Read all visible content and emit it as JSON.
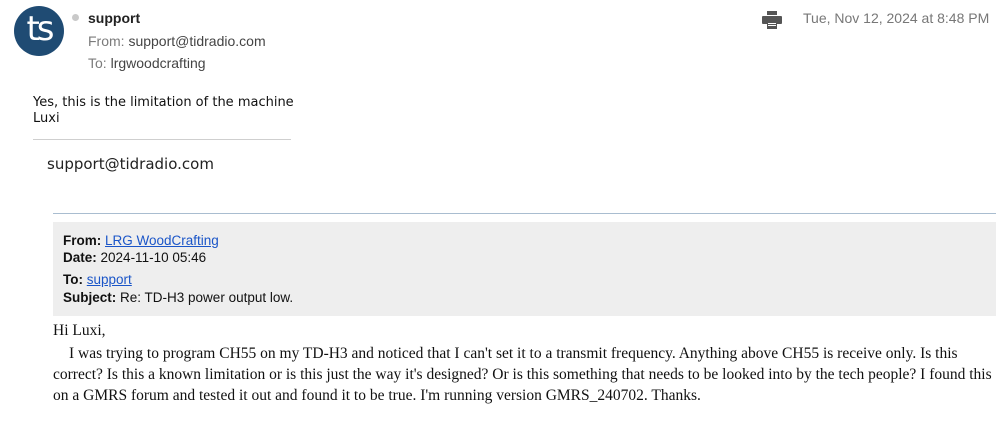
{
  "header": {
    "avatar_initials": "ts",
    "sender_name": "support",
    "from_label": "From:",
    "from_address": "support@tidradio.com",
    "to_label": "To:",
    "to_address": "lrgwoodcrafting",
    "print_icon": "printer-icon",
    "date": "Tue, Nov 12, 2024 at 8:48 PM"
  },
  "reply": {
    "line1": "Yes, this is the limitation of the machine",
    "line2": "Luxi",
    "signature": "support@tidradio.com"
  },
  "quoted": {
    "from_label": "From:",
    "from_link": "LRG WoodCrafting",
    "date_label": "Date:",
    "date_value": "2024-11-10 05:46",
    "to_label": "To:",
    "to_link": "support",
    "subject_label": "Subject:",
    "subject_value": "Re: TD-H3 power output low.",
    "greeting": "Hi Luxi,",
    "body": "I was trying to program CH55 on my TD-H3 and noticed that I can't set it to a transmit frequency.  Anything above CH55 is receive only.  Is this correct?  Is this a known limitation or is this just the way it's designed?  Or is this something that needs to be looked into by the tech people?  I found this on a GMRS forum and tested it out and found it to be true.  I'm running version GMRS_240702.  Thanks."
  },
  "colors": {
    "avatar_bg": "#1f4b73",
    "link": "#1a55c8",
    "quote_header_bg": "#eeeeee"
  }
}
